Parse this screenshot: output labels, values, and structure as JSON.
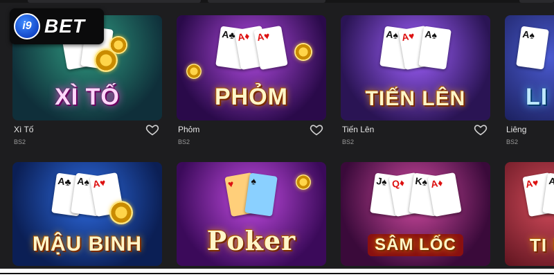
{
  "brand": {
    "badge": "i9",
    "name": "BET"
  },
  "games": [
    {
      "name": "Xì Tố",
      "provider": "BS2",
      "art_title": "XÌ TỐ",
      "bg": [
        "#1b6b5a",
        "#0f2f3a"
      ],
      "accent": "#ff4fd8",
      "favorite_icon": "heart-outline-icon"
    },
    {
      "name": "Phỏm",
      "provider": "BS2",
      "art_title": "PHỎM",
      "bg": [
        "#6a1fa0",
        "#2a0a4a"
      ],
      "accent": "#ffd34a",
      "favorite_icon": "heart-outline-icon"
    },
    {
      "name": "Tiến Lên",
      "provider": "BS2",
      "art_title": "TIẾN LÊN",
      "bg": [
        "#7a3bd0",
        "#2a1454"
      ],
      "accent": "#ffd34a",
      "favorite_icon": "heart-outline-icon"
    },
    {
      "name": "Liêng",
      "provider": "BS2",
      "art_title": "LI",
      "bg": [
        "#2b2f8a",
        "#13164a"
      ],
      "accent": "#4fc3ff",
      "favorite_icon": "heart-outline-icon"
    },
    {
      "name": "",
      "provider": "",
      "art_title": "MẬU BINH",
      "bg": [
        "#1c4fb0",
        "#0b1f55"
      ],
      "accent": "#ffd34a"
    },
    {
      "name": "",
      "provider": "",
      "art_title": "Poker",
      "bg": [
        "#8a1fb0",
        "#3b0a5a"
      ],
      "accent": "#ffd34a"
    },
    {
      "name": "",
      "provider": "",
      "art_title": "SÂM LỐC",
      "bg": [
        "#a0287a",
        "#3a0a3a"
      ],
      "accent": "#ffd34a"
    },
    {
      "name": "",
      "provider": "",
      "art_title": "TI M",
      "bg": [
        "#b0283a",
        "#4a0a14"
      ],
      "accent": "#ffd34a"
    }
  ]
}
